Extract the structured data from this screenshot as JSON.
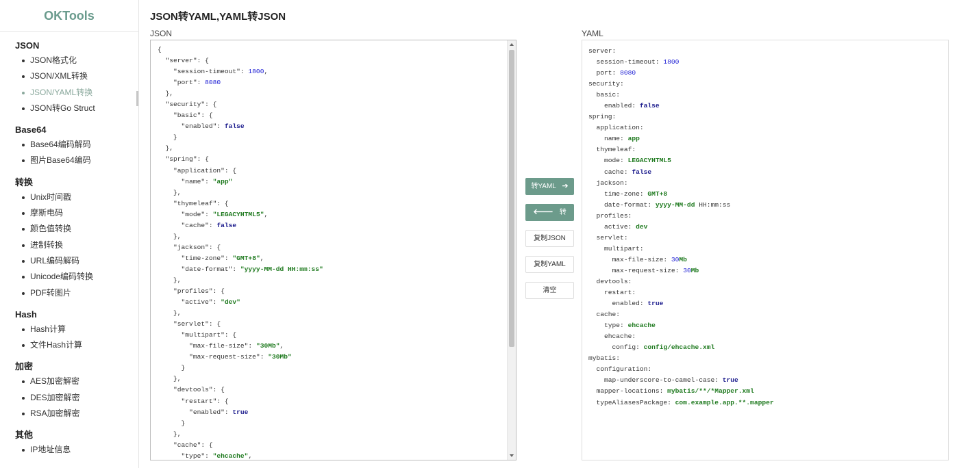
{
  "brand": "OKTools",
  "page_title": "JSON转YAML,YAML转JSON",
  "colors": {
    "accent": "#6c9b8b",
    "brand": "#6a9b8d",
    "active_nav": "#8aa89c"
  },
  "sidebar": {
    "groups": [
      {
        "title": "JSON",
        "items": [
          {
            "label": "JSON格式化"
          },
          {
            "label": "JSON/XML转换"
          },
          {
            "label": "JSON/YAML转换",
            "active": true
          },
          {
            "label": "JSON转Go Struct"
          }
        ]
      },
      {
        "title": "Base64",
        "items": [
          {
            "label": "Base64编码解码"
          },
          {
            "label": "图片Base64编码"
          }
        ]
      },
      {
        "title": "转换",
        "items": [
          {
            "label": "Unix时间戳"
          },
          {
            "label": "摩斯电码"
          },
          {
            "label": "颜色值转换"
          },
          {
            "label": "进制转换"
          },
          {
            "label": "URL编码解码"
          },
          {
            "label": "Unicode编码转换"
          },
          {
            "label": "PDF转图片"
          }
        ]
      },
      {
        "title": "Hash",
        "items": [
          {
            "label": "Hash计算"
          },
          {
            "label": "文件Hash计算"
          }
        ]
      },
      {
        "title": "加密",
        "items": [
          {
            "label": "AES加密解密"
          },
          {
            "label": "DES加密解密"
          },
          {
            "label": "RSA加密解密"
          }
        ]
      },
      {
        "title": "其他",
        "items": [
          {
            "label": "IP地址信息"
          }
        ]
      }
    ]
  },
  "json_panel": {
    "label": "JSON",
    "lines": [
      [
        [
          "p",
          "{"
        ]
      ],
      [
        [
          "p",
          "  "
        ],
        [
          "k",
          "\"server\""
        ],
        [
          "p",
          ": {"
        ]
      ],
      [
        [
          "p",
          "    "
        ],
        [
          "k",
          "\"session-timeout\""
        ],
        [
          "p",
          ": "
        ],
        [
          "n",
          "1800"
        ],
        [
          "p",
          ","
        ]
      ],
      [
        [
          "p",
          "    "
        ],
        [
          "k",
          "\"port\""
        ],
        [
          "p",
          ": "
        ],
        [
          "n",
          "8080"
        ]
      ],
      [
        [
          "p",
          "  },"
        ]
      ],
      [
        [
          "p",
          "  "
        ],
        [
          "k",
          "\"security\""
        ],
        [
          "p",
          ": {"
        ]
      ],
      [
        [
          "p",
          "    "
        ],
        [
          "k",
          "\"basic\""
        ],
        [
          "p",
          ": {"
        ]
      ],
      [
        [
          "p",
          "      "
        ],
        [
          "k",
          "\"enabled\""
        ],
        [
          "p",
          ": "
        ],
        [
          "b",
          "false"
        ]
      ],
      [
        [
          "p",
          "    }"
        ]
      ],
      [
        [
          "p",
          "  },"
        ]
      ],
      [
        [
          "p",
          "  "
        ],
        [
          "k",
          "\"spring\""
        ],
        [
          "p",
          ": {"
        ]
      ],
      [
        [
          "p",
          "    "
        ],
        [
          "k",
          "\"application\""
        ],
        [
          "p",
          ": {"
        ]
      ],
      [
        [
          "p",
          "      "
        ],
        [
          "k",
          "\"name\""
        ],
        [
          "p",
          ": "
        ],
        [
          "s",
          "\"app\""
        ]
      ],
      [
        [
          "p",
          "    },"
        ]
      ],
      [
        [
          "p",
          "    "
        ],
        [
          "k",
          "\"thymeleaf\""
        ],
        [
          "p",
          ": {"
        ]
      ],
      [
        [
          "p",
          "      "
        ],
        [
          "k",
          "\"mode\""
        ],
        [
          "p",
          ": "
        ],
        [
          "s",
          "\"LEGACYHTML5\""
        ],
        [
          "p",
          ","
        ]
      ],
      [
        [
          "p",
          "      "
        ],
        [
          "k",
          "\"cache\""
        ],
        [
          "p",
          ": "
        ],
        [
          "b",
          "false"
        ]
      ],
      [
        [
          "p",
          "    },"
        ]
      ],
      [
        [
          "p",
          "    "
        ],
        [
          "k",
          "\"jackson\""
        ],
        [
          "p",
          ": {"
        ]
      ],
      [
        [
          "p",
          "      "
        ],
        [
          "k",
          "\"time-zone\""
        ],
        [
          "p",
          ": "
        ],
        [
          "s",
          "\"GMT+8\""
        ],
        [
          "p",
          ","
        ]
      ],
      [
        [
          "p",
          "      "
        ],
        [
          "k",
          "\"date-format\""
        ],
        [
          "p",
          ": "
        ],
        [
          "s",
          "\"yyyy-MM-dd HH:mm:ss\""
        ]
      ],
      [
        [
          "p",
          "    },"
        ]
      ],
      [
        [
          "p",
          "    "
        ],
        [
          "k",
          "\"profiles\""
        ],
        [
          "p",
          ": {"
        ]
      ],
      [
        [
          "p",
          "      "
        ],
        [
          "k",
          "\"active\""
        ],
        [
          "p",
          ": "
        ],
        [
          "s",
          "\"dev\""
        ]
      ],
      [
        [
          "p",
          "    },"
        ]
      ],
      [
        [
          "p",
          "    "
        ],
        [
          "k",
          "\"servlet\""
        ],
        [
          "p",
          ": {"
        ]
      ],
      [
        [
          "p",
          "      "
        ],
        [
          "k",
          "\"multipart\""
        ],
        [
          "p",
          ": {"
        ]
      ],
      [
        [
          "p",
          "        "
        ],
        [
          "k",
          "\"max-file-size\""
        ],
        [
          "p",
          ": "
        ],
        [
          "s",
          "\"30Mb\""
        ],
        [
          "p",
          ","
        ]
      ],
      [
        [
          "p",
          "        "
        ],
        [
          "k",
          "\"max-request-size\""
        ],
        [
          "p",
          ": "
        ],
        [
          "s",
          "\"30Mb\""
        ]
      ],
      [
        [
          "p",
          "      }"
        ]
      ],
      [
        [
          "p",
          "    },"
        ]
      ],
      [
        [
          "p",
          "    "
        ],
        [
          "k",
          "\"devtools\""
        ],
        [
          "p",
          ": {"
        ]
      ],
      [
        [
          "p",
          "      "
        ],
        [
          "k",
          "\"restart\""
        ],
        [
          "p",
          ": {"
        ]
      ],
      [
        [
          "p",
          "        "
        ],
        [
          "k",
          "\"enabled\""
        ],
        [
          "p",
          ": "
        ],
        [
          "b",
          "true"
        ]
      ],
      [
        [
          "p",
          "      }"
        ]
      ],
      [
        [
          "p",
          "    },"
        ]
      ],
      [
        [
          "p",
          "    "
        ],
        [
          "k",
          "\"cache\""
        ],
        [
          "p",
          ": {"
        ]
      ],
      [
        [
          "p",
          "      "
        ],
        [
          "k",
          "\"type\""
        ],
        [
          "p",
          ": "
        ],
        [
          "s",
          "\"ehcache\""
        ],
        [
          "p",
          ","
        ]
      ]
    ]
  },
  "yaml_panel": {
    "label": "YAML",
    "lines": [
      [
        [
          "k",
          "server:"
        ]
      ],
      [
        [
          "k",
          "  session-timeout: "
        ],
        [
          "n",
          "1800"
        ]
      ],
      [
        [
          "k",
          "  port: "
        ],
        [
          "n",
          "8080"
        ]
      ],
      [
        [
          "k",
          "security:"
        ]
      ],
      [
        [
          "k",
          "  basic:"
        ]
      ],
      [
        [
          "k",
          "    enabled: "
        ],
        [
          "b",
          "false"
        ]
      ],
      [
        [
          "k",
          "spring:"
        ]
      ],
      [
        [
          "k",
          "  application:"
        ]
      ],
      [
        [
          "k",
          "    name: "
        ],
        [
          "s",
          "app"
        ]
      ],
      [
        [
          "k",
          "  thymeleaf:"
        ]
      ],
      [
        [
          "k",
          "    mode: "
        ],
        [
          "s",
          "LEGACYHTML5"
        ]
      ],
      [
        [
          "k",
          "    cache: "
        ],
        [
          "b",
          "false"
        ]
      ],
      [
        [
          "k",
          "  jackson:"
        ]
      ],
      [
        [
          "k",
          "    time-zone: "
        ],
        [
          "s",
          "GMT+8"
        ]
      ],
      [
        [
          "k",
          "    date-format: "
        ],
        [
          "s",
          "yyyy-MM-dd"
        ],
        [
          "k",
          " HH:mm:ss"
        ]
      ],
      [
        [
          "k",
          "  profiles:"
        ]
      ],
      [
        [
          "k",
          "    active: "
        ],
        [
          "s",
          "dev"
        ]
      ],
      [
        [
          "k",
          "  servlet:"
        ]
      ],
      [
        [
          "k",
          "    multipart:"
        ]
      ],
      [
        [
          "k",
          "      max-file-size: "
        ],
        [
          "n",
          "30"
        ],
        [
          "s",
          "Mb"
        ]
      ],
      [
        [
          "k",
          "      max-request-size: "
        ],
        [
          "n",
          "30"
        ],
        [
          "s",
          "Mb"
        ]
      ],
      [
        [
          "k",
          "  devtools:"
        ]
      ],
      [
        [
          "k",
          "    restart:"
        ]
      ],
      [
        [
          "k",
          "      enabled: "
        ],
        [
          "b",
          "true"
        ]
      ],
      [
        [
          "k",
          "  cache:"
        ]
      ],
      [
        [
          "k",
          "    type: "
        ],
        [
          "s",
          "ehcache"
        ]
      ],
      [
        [
          "k",
          "    ehcache:"
        ]
      ],
      [
        [
          "k",
          "      config: "
        ],
        [
          "s",
          "config/ehcache.xml"
        ]
      ],
      [
        [
          "k",
          "mybatis:"
        ]
      ],
      [
        [
          "k",
          "  configuration:"
        ]
      ],
      [
        [
          "k",
          "    map-underscore-to-camel-case: "
        ],
        [
          "b",
          "true"
        ]
      ],
      [
        [
          "k",
          "  mapper-locations: "
        ],
        [
          "s",
          "mybatis/**/*Mapper.xml"
        ]
      ],
      [
        [
          "k",
          "  typeAliasesPackage: "
        ],
        [
          "s",
          "com.example.app.**.mapper"
        ]
      ]
    ]
  },
  "buttons": {
    "to_yaml": {
      "label": "转YAML",
      "icon": "arrow-right-icon"
    },
    "to_json": {
      "label": "转JSON",
      "icon": "arrow-left-icon"
    },
    "copy_json": "复制JSON",
    "copy_yaml": "复制YAML",
    "clear": "清空"
  }
}
